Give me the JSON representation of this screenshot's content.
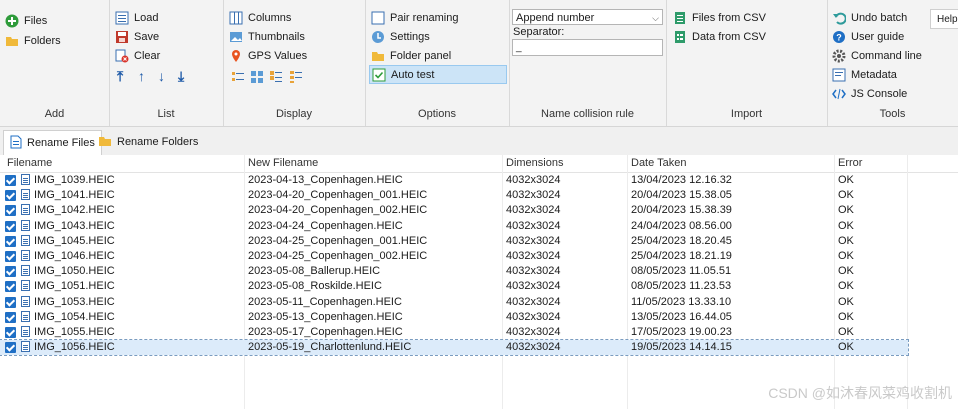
{
  "ribbon": {
    "add": {
      "title": "Add",
      "files": "Files",
      "folders": "Folders"
    },
    "list": {
      "title": "List",
      "load": "Load",
      "save": "Save",
      "clear": "Clear"
    },
    "display": {
      "title": "Display",
      "columns": "Columns",
      "thumbnails": "Thumbnails",
      "gps": "GPS Values"
    },
    "options": {
      "title": "Options",
      "pair": "Pair renaming",
      "settings": "Settings",
      "folder_panel": "Folder panel",
      "auto_test": "Auto test"
    },
    "collision": {
      "title": "Name collision rule",
      "selected": "Append number",
      "separator_label": "Separator:",
      "separator_value": "_"
    },
    "import": {
      "title": "Import",
      "files_csv": "Files from CSV",
      "data_csv": "Data from CSV"
    },
    "tools": {
      "title": "Tools",
      "undo": "Undo batch",
      "guide": "User guide",
      "cmd": "Command line",
      "metadata": "Metadata",
      "js": "JS Console"
    },
    "help": "Help"
  },
  "tabs": [
    {
      "label": "Rename Files"
    },
    {
      "label": "Rename Folders"
    }
  ],
  "table": {
    "headers": [
      "Filename",
      "New Filename",
      "Dimensions",
      "Date Taken",
      "Error"
    ],
    "rows": [
      [
        "IMG_1039.HEIC",
        "2023-04-13_Copenhagen.HEIC",
        "4032x3024",
        "13/04/2023 12.16.32",
        "OK"
      ],
      [
        "IMG_1041.HEIC",
        "2023-04-20_Copenhagen_001.HEIC",
        "4032x3024",
        "20/04/2023 15.38.05",
        "OK"
      ],
      [
        "IMG_1042.HEIC",
        "2023-04-20_Copenhagen_002.HEIC",
        "4032x3024",
        "20/04/2023 15.38.39",
        "OK"
      ],
      [
        "IMG_1043.HEIC",
        "2023-04-24_Copenhagen.HEIC",
        "4032x3024",
        "24/04/2023 08.56.00",
        "OK"
      ],
      [
        "IMG_1045.HEIC",
        "2023-04-25_Copenhagen_001.HEIC",
        "4032x3024",
        "25/04/2023 18.20.45",
        "OK"
      ],
      [
        "IMG_1046.HEIC",
        "2023-04-25_Copenhagen_002.HEIC",
        "4032x3024",
        "25/04/2023 18.21.19",
        "OK"
      ],
      [
        "IMG_1050.HEIC",
        "2023-05-08_Ballerup.HEIC",
        "4032x3024",
        "08/05/2023 11.05.51",
        "OK"
      ],
      [
        "IMG_1051.HEIC",
        "2023-05-08_Roskilde.HEIC",
        "4032x3024",
        "08/05/2023 11.23.53",
        "OK"
      ],
      [
        "IMG_1053.HEIC",
        "2023-05-11_Copenhagen.HEIC",
        "4032x3024",
        "11/05/2023 13.33.10",
        "OK"
      ],
      [
        "IMG_1054.HEIC",
        "2023-05-13_Copenhagen.HEIC",
        "4032x3024",
        "13/05/2023 16.44.05",
        "OK"
      ],
      [
        "IMG_1055.HEIC",
        "2023-05-17_Copenhagen.HEIC",
        "4032x3024",
        "17/05/2023 19.00.23",
        "OK"
      ],
      [
        "IMG_1056.HEIC",
        "2023-05-19_Charlottenlund.HEIC",
        "4032x3024",
        "19/05/2023 14.14.15",
        "OK"
      ]
    ]
  },
  "watermark": "CSDN @如沐春风菜鸡收割机",
  "colors": {
    "accent": "#1f6fc5",
    "selection": "#cce4f7",
    "ribbon_bg": "#f3f3f3"
  }
}
